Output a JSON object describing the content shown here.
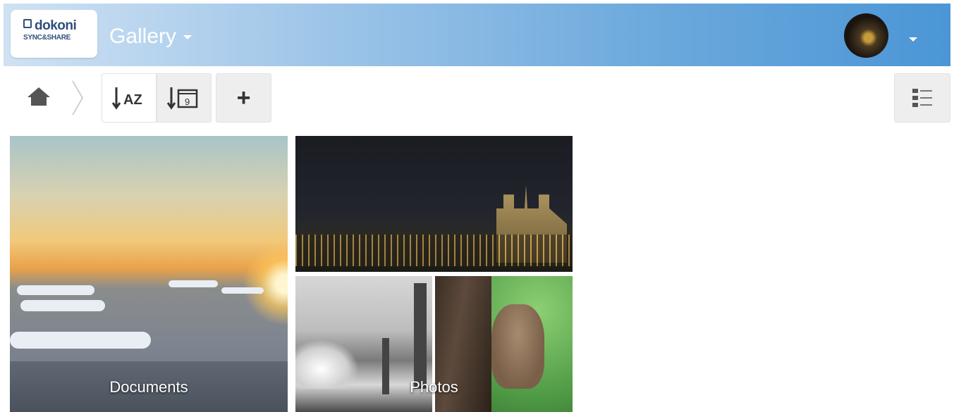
{
  "header": {
    "logo": {
      "brand": "dokoni",
      "sub": "SYNC&SHARE",
      "tagline": ""
    },
    "title": "Gallery",
    "colors": {
      "gradient_start": "#cfe2f3",
      "gradient_end": "#4b96d6"
    }
  },
  "toolbar": {
    "add_label": "+",
    "sort_name_icon": "sort-alpha-icon",
    "sort_date_icon": "sort-date-icon",
    "sort_name_text": "AZ",
    "sort_date_text": "9",
    "view_icon": "list-view-icon"
  },
  "tiles": [
    {
      "label": "Documents"
    },
    {
      "label": "Photos"
    }
  ]
}
